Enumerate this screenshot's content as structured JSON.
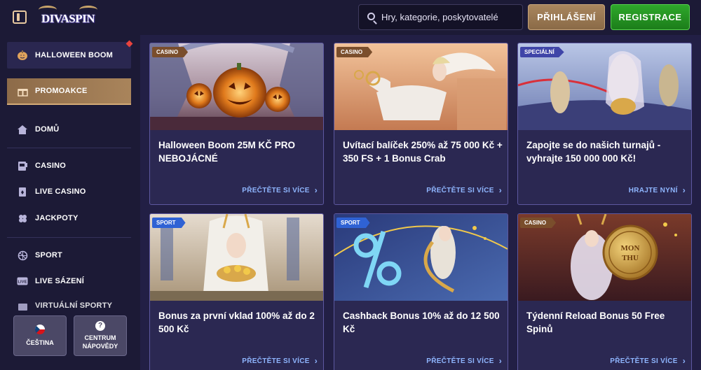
{
  "header": {
    "logo_text": "DIVASPIN",
    "search_placeholder": "Hry, kategorie, poskytovatelé",
    "login_label": "PŘIHLÁŠENÍ",
    "register_label": "REGISTRACE"
  },
  "sidebar": {
    "items": [
      {
        "label": "HALLOWEEN BOOM",
        "icon": "pumpkin-icon"
      },
      {
        "label": "PROMOAKCE",
        "icon": "gift-icon"
      },
      {
        "label": "DOMŮ",
        "icon": "home-icon"
      },
      {
        "label": "CASINO",
        "icon": "slot-machine-icon"
      },
      {
        "label": "LIVE CASINO",
        "icon": "cards-icon"
      },
      {
        "label": "JACKPOTY",
        "icon": "clover-icon"
      },
      {
        "label": "SPORT",
        "icon": "ball-icon"
      },
      {
        "label": "LIVE SÁZENÍ",
        "icon": "live-icon"
      },
      {
        "label": "VIRTUÁLNÍ SPORTY",
        "icon": "virtual-sport-icon"
      }
    ],
    "language": {
      "label": "ČEŠTINA",
      "icon": "czech-flag-icon"
    },
    "help": {
      "label_line1": "CENTRUM",
      "label_line2": "NÁPOVĚDY",
      "icon_glyph": "?"
    }
  },
  "cards": [
    {
      "tag": "CASINO",
      "title": "Halloween Boom 25M KČ PRO NEBOJÁCNÉ",
      "link": "PŘEČTĚTE SI VÍCE"
    },
    {
      "tag": "CASINO",
      "title": "Uvítací balíček 250% až 75 000 Kč + 350 FS + 1 Bonus Crab",
      "link": "PŘEČTĚTE SI VÍCE"
    },
    {
      "tag": "SPECIÁLNÍ",
      "title": "Zapojte se do našich turnajů - vyhrajte 150 000 000 Kč!",
      "link": "HRAJTE NYNÍ"
    },
    {
      "tag": "SPORT",
      "title": "Bonus za první vklad 100% až do 2 500 Kč",
      "link": "PŘEČTĚTE SI VÍCE"
    },
    {
      "tag": "SPORT",
      "title": "Cashback Bonus 10% až do 12 500 Kč",
      "link": "PŘEČTĚTE SI VÍCE"
    },
    {
      "tag": "CASINO",
      "title": "Týdenní Reload Bonus 50 Free Spinů",
      "link": "PŘEČTĚTE SI VÍCE"
    }
  ],
  "card_images": {
    "c6_coin_line1": "MON",
    "c6_coin_line2": "THU"
  },
  "colors": {
    "accent_gold": "#a9865e",
    "register_green": "#2ea82b",
    "link_blue": "#8fb6ff",
    "background": "#1f1d3d"
  }
}
